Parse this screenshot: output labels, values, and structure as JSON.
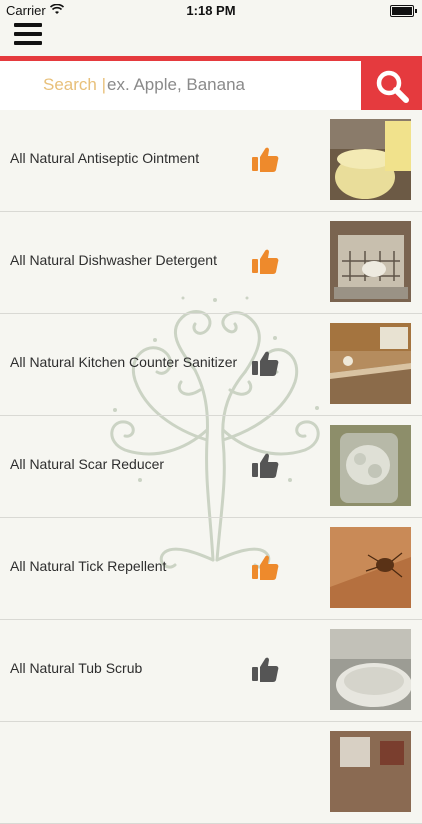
{
  "status_bar": {
    "carrier": "Carrier",
    "time": "1:18 PM"
  },
  "search": {
    "prefix": "Search |",
    "placeholder": "ex. Apple, Banana"
  },
  "colors": {
    "accent": "#e53a3e",
    "thumb_liked": "#ee8a2c",
    "thumb_neutral": "#555555"
  },
  "items": [
    {
      "label": "All Natural Antiseptic Ointment",
      "thumb": "liked",
      "image": "ointment-jar-photo"
    },
    {
      "label": "All Natural Dishwasher Detergent",
      "thumb": "liked",
      "image": "dishwasher-photo"
    },
    {
      "label": "All Natural Kitchen Counter Sanitizer",
      "thumb": "neutral",
      "image": "kitchen-counter-photo"
    },
    {
      "label": "All Natural Scar Reducer",
      "thumb": "neutral",
      "image": "scar-cream-jar-photo"
    },
    {
      "label": "All Natural Tick Repellent",
      "thumb": "liked",
      "image": "tick-photo"
    },
    {
      "label": "All Natural Tub Scrub",
      "thumb": "neutral",
      "image": "bathtub-photo"
    },
    {
      "label": "",
      "thumb": "none",
      "image": "room-photo"
    }
  ]
}
